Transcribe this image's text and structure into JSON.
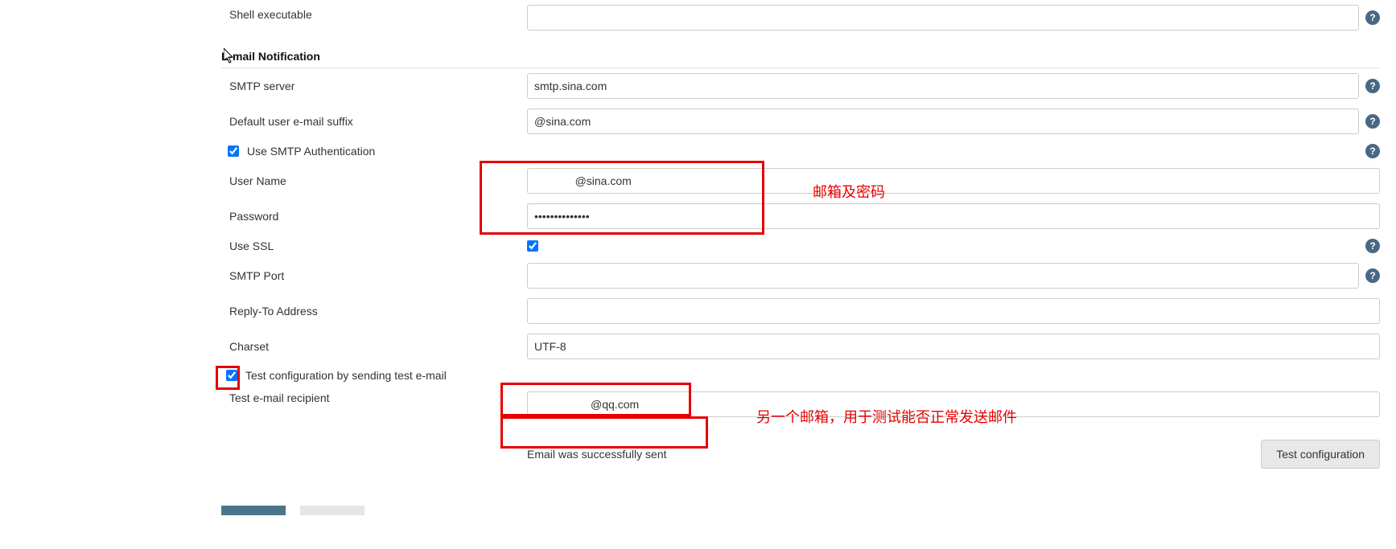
{
  "topPartial": {
    "label": "Shell executable"
  },
  "sectionTitle": "E-mail Notification",
  "smtp": {
    "label": "SMTP server",
    "value": "smtp.sina.com"
  },
  "suffix": {
    "label": "Default user e-mail suffix",
    "value": "@sina.com"
  },
  "useSmtpAuth": {
    "label": "Use SMTP Authentication"
  },
  "userName": {
    "label": "User Name",
    "value": "             @sina.com"
  },
  "password": {
    "label": "Password",
    "value": "••••••••••••••"
  },
  "useSsl": {
    "label": "Use SSL"
  },
  "smtpPort": {
    "label": "SMTP Port",
    "value": ""
  },
  "replyTo": {
    "label": "Reply-To Address",
    "value": ""
  },
  "charset": {
    "label": "Charset",
    "value": "UTF-8"
  },
  "testConfig": {
    "label": "Test configuration by sending test e-mail"
  },
  "testRecipient": {
    "label": "Test e-mail recipient",
    "value": "                  @qq.com"
  },
  "statusMessage": "Email was successfully sent",
  "testButton": "Test configuration",
  "annotations": {
    "credentials": "邮箱及密码",
    "testMail": "另一个邮箱，用于测试能否正常发送邮件"
  },
  "helpGlyph": "?"
}
